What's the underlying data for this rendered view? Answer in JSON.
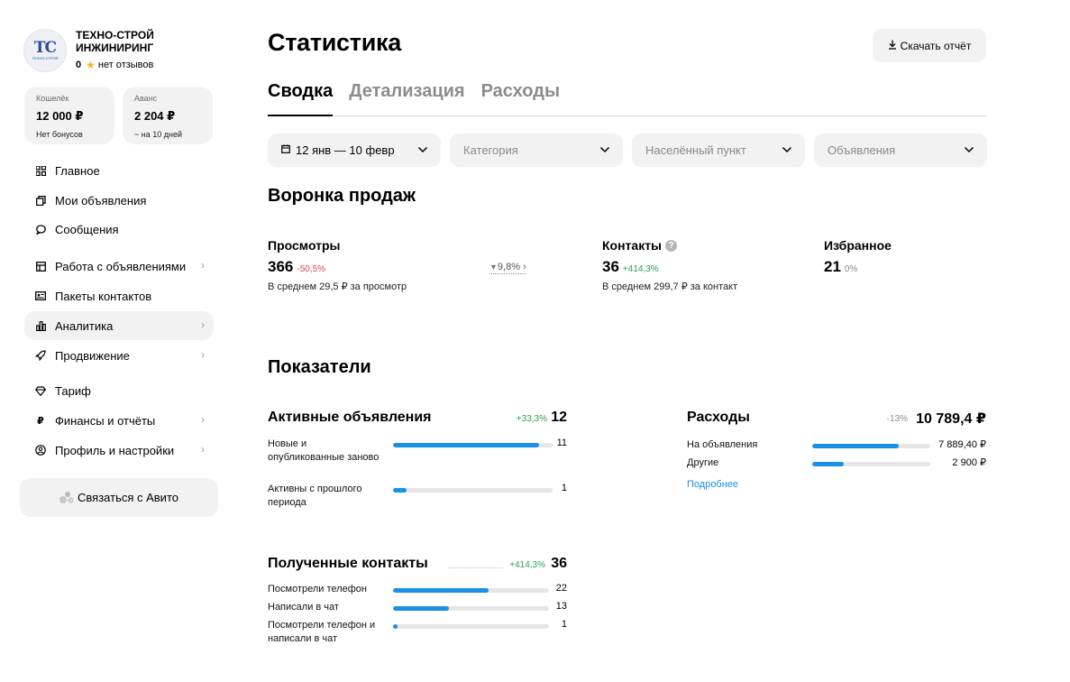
{
  "sidebar": {
    "company": {
      "logo_text": "ТС",
      "logo_sub": "ТЕХНО-СТРОЙ",
      "name": "ТЕХНО-СТРОЙ ИНЖИНИРИНГ",
      "rating": "0",
      "reviews": "нет отзывов"
    },
    "wallet": {
      "label": "Кошелёк",
      "value": "12 000 ₽",
      "sub": "Нет бонусов"
    },
    "advance": {
      "label": "Аванс",
      "value": "2 204 ₽",
      "sub": "~ на 10 дней"
    },
    "nav": [
      {
        "label": "Главное",
        "icon": "grid-icon",
        "chevron": false,
        "active": false
      },
      {
        "label": "Мои объявления",
        "icon": "copy-icon",
        "chevron": false,
        "active": false
      },
      {
        "label": "Сообщения",
        "icon": "chat-icon",
        "chevron": false,
        "active": false
      },
      {
        "label": "Работа с объявлениями",
        "icon": "board-icon",
        "chevron": true,
        "active": false
      },
      {
        "label": "Пакеты контактов",
        "icon": "contact-card-icon",
        "chevron": false,
        "active": false
      },
      {
        "label": "Аналитика",
        "icon": "bar-chart-icon",
        "chevron": true,
        "active": true
      },
      {
        "label": "Продвижение",
        "icon": "rocket-icon",
        "chevron": true,
        "active": false
      },
      {
        "label": "Тариф",
        "icon": "diamond-icon",
        "chevron": false,
        "active": false
      },
      {
        "label": "Финансы и отчёты",
        "icon": "ruble-icon",
        "chevron": true,
        "active": false
      },
      {
        "label": "Профиль и настройки",
        "icon": "user-circle-icon",
        "chevron": true,
        "active": false
      }
    ],
    "contact_button": "Связаться с Авито"
  },
  "header": {
    "title": "Статистика",
    "download_label": "Скачать отчёт"
  },
  "tabs": [
    {
      "label": "Сводка",
      "active": true
    },
    {
      "label": "Детализация",
      "active": false
    },
    {
      "label": "Расходы",
      "active": false
    }
  ],
  "filters": {
    "period": "12 янв — 10 февр",
    "category_placeholder": "Категория",
    "location_placeholder": "Населённый пункт",
    "ads_placeholder": "Объявления"
  },
  "funnel": {
    "title": "Воронка продаж",
    "views": {
      "label": "Просмотры",
      "value": "366",
      "delta": "-50,5%",
      "sub": "В среднем 29,5 ₽ за просмотр"
    },
    "conversion": "9,8%",
    "contacts": {
      "label": "Контакты",
      "value": "36",
      "delta": "+414,3%",
      "sub": "В среднем 299,7 ₽ за контакт"
    },
    "favorites": {
      "label": "Избранное",
      "value": "21",
      "delta": "0%"
    }
  },
  "indicators": {
    "title": "Показатели",
    "active_ads": {
      "title": "Активные объявления",
      "delta": "+33,3%",
      "total": "12",
      "rows": [
        {
          "label": "Новые и опубликованные заново",
          "value": "11",
          "fraction": 0.917
        },
        {
          "label": "Активны с прошлого периода",
          "value": "1",
          "fraction": 0.083
        }
      ]
    },
    "expenses": {
      "title": "Расходы",
      "delta": "-13%",
      "total": "10 789,4 ₽",
      "rows": [
        {
          "label": "На объявления",
          "value": "7 889,40 ₽",
          "fraction": 0.731
        },
        {
          "label": "Другие",
          "value": "2 900 ₽",
          "fraction": 0.269
        }
      ],
      "more_link": "Подробнее"
    },
    "contacts": {
      "title": "Полученные контакты",
      "delta": "+414,3%",
      "total": "36",
      "rows": [
        {
          "label": "Посмотрели телефон",
          "value": "22",
          "fraction": 0.611
        },
        {
          "label": "Написали в чат",
          "value": "13",
          "fraction": 0.361
        },
        {
          "label": "Посмотрели телефон и написали в чат",
          "value": "1",
          "fraction": 0.028
        }
      ]
    }
  },
  "colors": {
    "accent_blue": "#1a8fe6",
    "negative_red": "#e34545",
    "positive_green": "#2aa14a",
    "panel_gray": "#f2f2f2",
    "star": "#ffb021"
  }
}
